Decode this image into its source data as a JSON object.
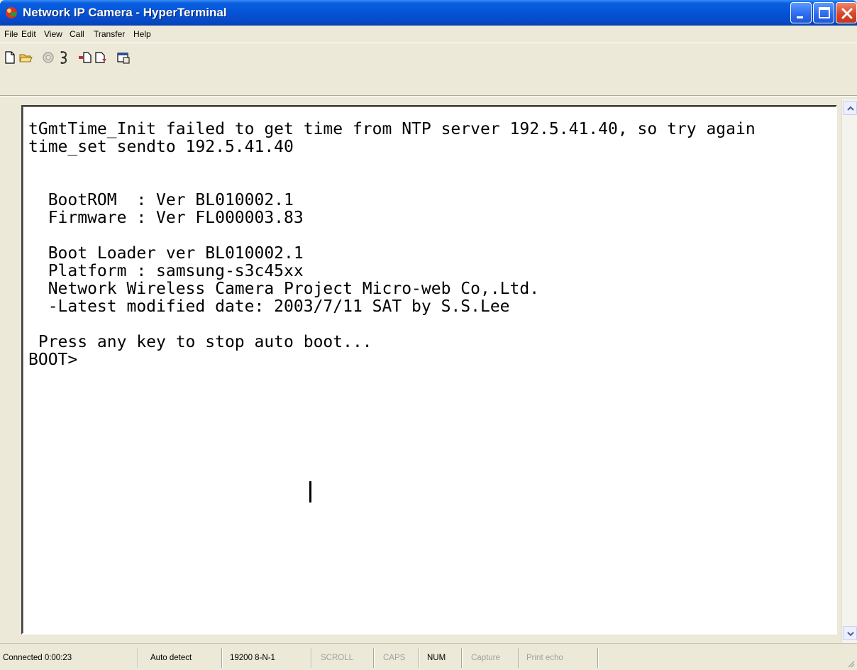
{
  "window": {
    "title": "Network IP Camera - HyperTerminal"
  },
  "menu": {
    "items": [
      "File",
      "Edit",
      "View",
      "Call",
      "Transfer",
      "Help"
    ]
  },
  "toolbar": {
    "icons": [
      "new-connection-icon",
      "open-icon",
      "disconnect-icon",
      "connect-icon",
      "send-icon",
      "receive-icon",
      "properties-icon"
    ]
  },
  "terminal": {
    "lines": [
      "tGmtTime_Init failed to get time from NTP server 192.5.41.40, so try again",
      "time_set sendto 192.5.41.40",
      "",
      "",
      "  BootROM  : Ver BL010002.1",
      "  Firmware : Ver FL000003.83",
      "",
      "  Boot Loader ver BL010002.1",
      "  Platform : samsung-s3c45xx",
      "  Network Wireless Camera Project Micro-web Co,.Ltd.",
      "  -Latest modified date: 2003/7/11 SAT by S.S.Lee",
      "",
      " Press any key to stop auto boot...",
      "BOOT>"
    ]
  },
  "statusbar": {
    "connected": "Connected 0:00:23",
    "detect": "Auto detect",
    "settings": "19200 8-N-1",
    "scroll": "SCROLL",
    "caps": "CAPS",
    "num": "NUM",
    "capture": "Capture",
    "print_echo": "Print echo"
  },
  "colors": {
    "titlebar": "#0553d6",
    "close_button": "#d8482a",
    "window_face": "#ece9d8"
  }
}
